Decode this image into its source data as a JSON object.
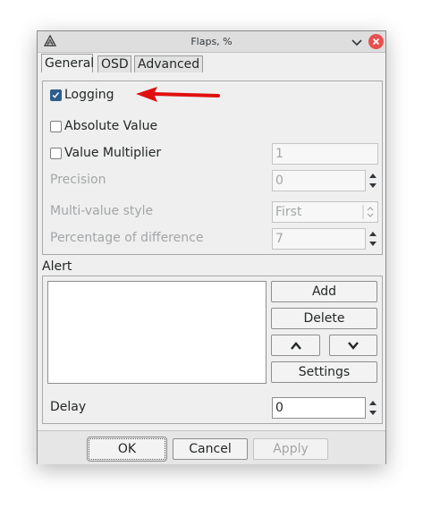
{
  "window": {
    "title": "Flaps, %"
  },
  "tabs": [
    {
      "label": "General",
      "active": true
    },
    {
      "label": "OSD",
      "active": false
    },
    {
      "label": "Advanced",
      "active": false
    }
  ],
  "general": {
    "logging": {
      "label": "Logging",
      "checked": true
    },
    "absolute_value": {
      "label": "Absolute Value",
      "checked": false
    },
    "value_multiplier": {
      "label": "Value Multiplier",
      "checked": false,
      "value": "1"
    },
    "precision": {
      "label": "Precision",
      "value": "0"
    },
    "multi_value_style": {
      "label": "Multi-value style",
      "value": "First"
    },
    "percentage_difference": {
      "label": "Percentage of difference",
      "value": "7"
    }
  },
  "alert": {
    "label": "Alert",
    "add_label": "Add",
    "delete_label": "Delete",
    "settings_label": "Settings",
    "delay_label": "Delay",
    "delay_value": "0"
  },
  "footer": {
    "ok_label": "OK",
    "cancel_label": "Cancel",
    "apply_label": "Apply"
  },
  "colors": {
    "annotation_arrow": "#e01010",
    "checkbox_accent": "#2e5d8e",
    "close_button": "#e8504f"
  }
}
